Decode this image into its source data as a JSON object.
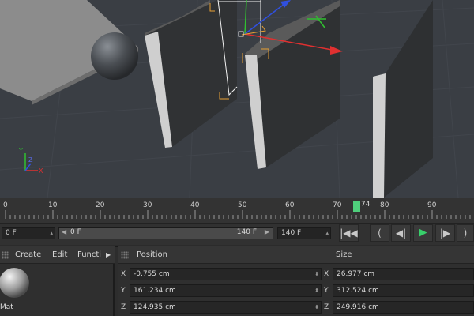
{
  "viewport": {
    "axis_labels": {
      "y": "Y",
      "z": "Z",
      "x": "X"
    }
  },
  "timeline": {
    "ticks": [
      "0",
      "10",
      "20",
      "30",
      "40",
      "50",
      "60",
      "70",
      "80",
      "90"
    ],
    "current_frame": "74"
  },
  "frame_controls": {
    "start_field": "0 F",
    "range_start": "0 F",
    "range_end": "140 F",
    "end_field": "140 F"
  },
  "material_manager": {
    "menu": [
      "Create",
      "Edit",
      "Functi"
    ],
    "material_label": "Mat"
  },
  "coordinates": {
    "position_header": "Position",
    "size_header": "Size",
    "axes": [
      "X",
      "Y",
      "Z"
    ],
    "position": [
      "-0.755 cm",
      "161.234 cm",
      "124.935 cm"
    ],
    "size": [
      "26.977 cm",
      "312.524 cm",
      "249.916 cm"
    ]
  },
  "colors": {
    "playhead": "#4fcf7c",
    "play_icon": "#38d06b",
    "x_axis": "#e03030",
    "y_axis": "#30c030",
    "z_axis": "#3050e0"
  }
}
